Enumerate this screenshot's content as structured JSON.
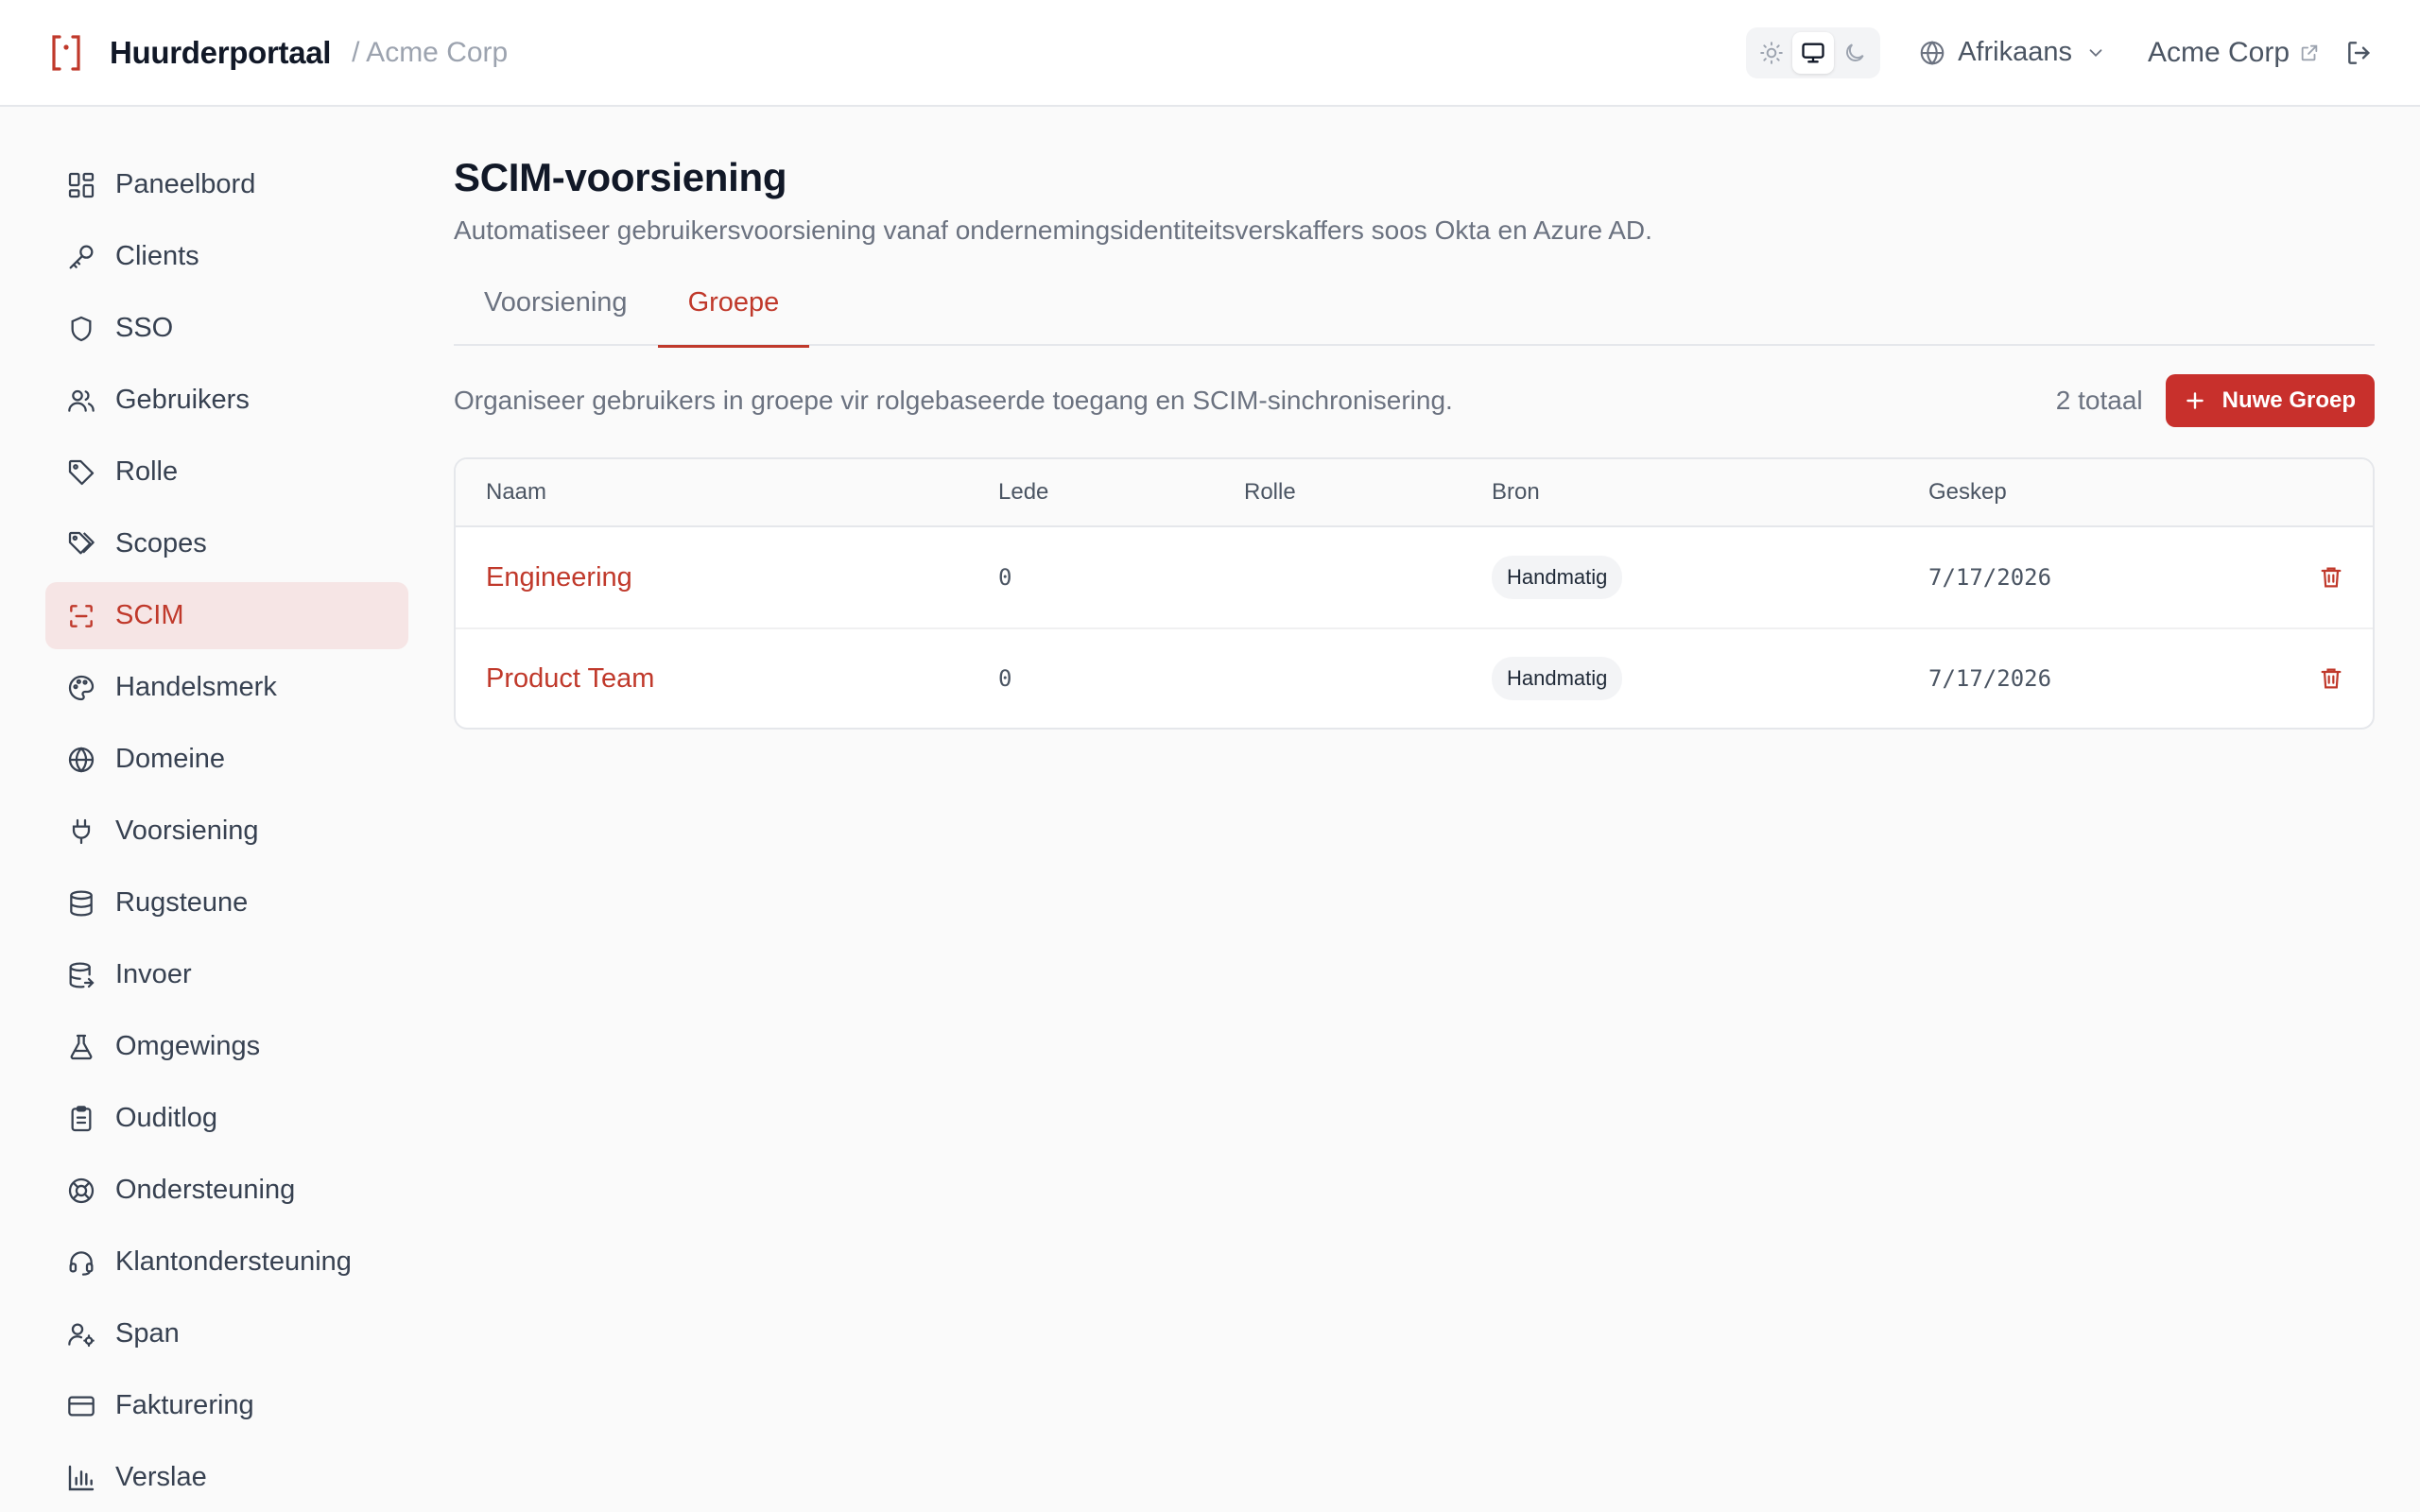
{
  "header": {
    "app_title": "Huurderportaal",
    "tenant_crumb": "/ Acme Corp",
    "language": "Afrikaans",
    "tenant_link": "Acme Corp",
    "theme_active": "system"
  },
  "sidebar": {
    "items": [
      {
        "label": "Paneelbord",
        "icon": "dashboard-icon"
      },
      {
        "label": "Clients",
        "icon": "key-icon"
      },
      {
        "label": "SSO",
        "icon": "shield-icon"
      },
      {
        "label": "Gebruikers",
        "icon": "users-icon"
      },
      {
        "label": "Rolle",
        "icon": "tag-icon"
      },
      {
        "label": "Scopes",
        "icon": "tags-icon"
      },
      {
        "label": "SCIM",
        "icon": "scan-icon",
        "active": true
      },
      {
        "label": "Handelsmerk",
        "icon": "palette-icon"
      },
      {
        "label": "Domeine",
        "icon": "globe-icon"
      },
      {
        "label": "Voorsiening",
        "icon": "plug-icon"
      },
      {
        "label": "Rugsteune",
        "icon": "database-icon"
      },
      {
        "label": "Invoer",
        "icon": "database-import-icon"
      },
      {
        "label": "Omgewings",
        "icon": "flask-icon"
      },
      {
        "label": "Ouditlog",
        "icon": "clipboard-icon"
      },
      {
        "label": "Ondersteuning",
        "icon": "lifebuoy-icon"
      },
      {
        "label": "Klantondersteuning",
        "icon": "headset-icon"
      },
      {
        "label": "Span",
        "icon": "user-cog-icon"
      },
      {
        "label": "Fakturering",
        "icon": "credit-card-icon"
      },
      {
        "label": "Verslae",
        "icon": "bar-chart-icon"
      }
    ]
  },
  "main": {
    "title": "SCIM-voorsiening",
    "subtitle": "Automatiseer gebruikersvoorsiening vanaf ondernemingsidentiteitsverskaffers soos Okta en Azure AD.",
    "tabs": [
      {
        "label": "Voorsiening",
        "active": false
      },
      {
        "label": "Groepe",
        "active": true
      }
    ],
    "groups_description": "Organiseer gebruikers in groepe vir rolgebaseerde toegang en SCIM-sinchronisering.",
    "total": "2 totaal",
    "new_button": "Nuwe Groep",
    "table": {
      "columns": [
        "Naam",
        "Lede",
        "Rolle",
        "Bron",
        "Geskep"
      ],
      "rows": [
        {
          "name": "Engineering",
          "members": "0",
          "roles": "",
          "source": "Handmatig",
          "created": "7/17/2026"
        },
        {
          "name": "Product Team",
          "members": "0",
          "roles": "",
          "source": "Handmatig",
          "created": "7/17/2026"
        }
      ]
    }
  },
  "colors": {
    "accent": "#c0392b",
    "button": "#c8302c",
    "active_nav_bg": "#f6e5e5"
  }
}
